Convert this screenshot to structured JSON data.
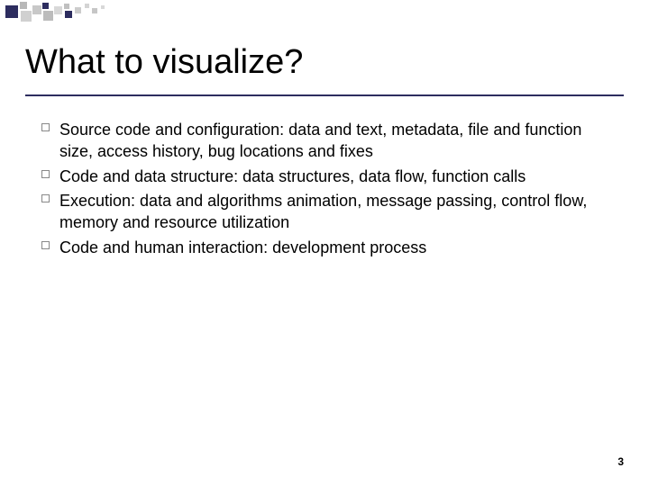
{
  "title": "What to visualize?",
  "bullets": [
    "Source code and configuration: data and text, metadata, file and function size, access history, bug locations and fixes",
    "Code and data structure: data structures, data flow, function calls",
    "Execution: data and algorithms animation, message passing, control flow, memory and resource utilization",
    "Code and human interaction: development process"
  ],
  "page_number": "3",
  "accent_color": "#2d2d5f"
}
